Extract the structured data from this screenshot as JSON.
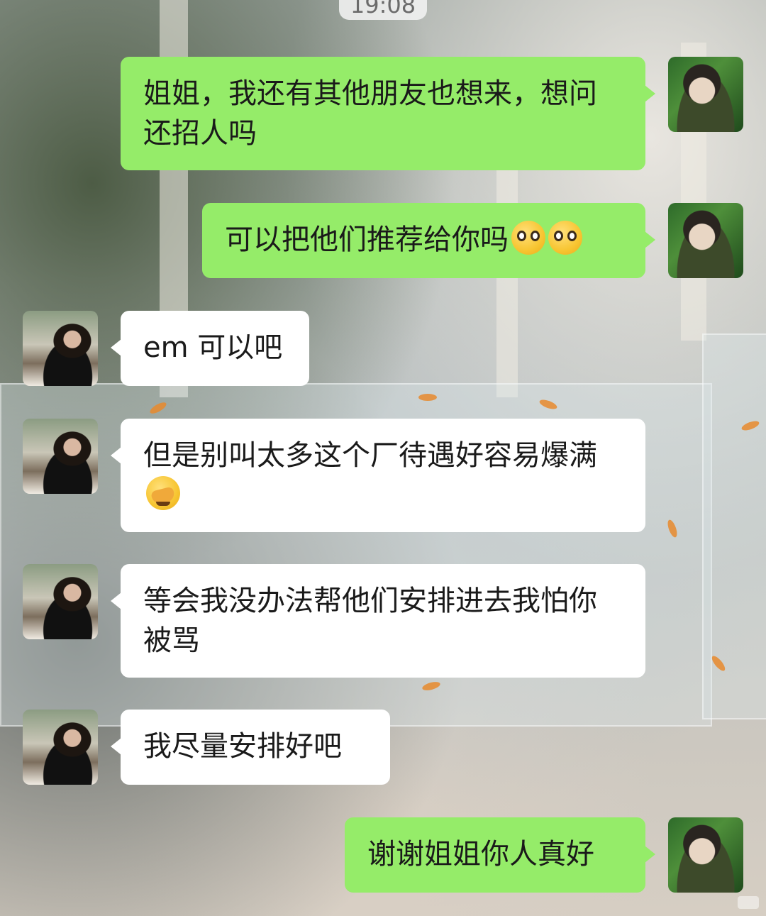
{
  "status": {
    "time": "19:08"
  },
  "messages": [
    {
      "from": "me",
      "text": "姐姐，我还有其他朋友也想来，想问还招人吗",
      "emoji": []
    },
    {
      "from": "me",
      "text": "可以把他们推荐给你吗",
      "emoji": [
        "pleading-face",
        "pleading-face"
      ]
    },
    {
      "from": "her",
      "text": "em 可以吧",
      "emoji": []
    },
    {
      "from": "her",
      "text": "但是别叫太多这个厂待遇好容易爆满",
      "emoji": [
        "face-with-hand-over-mouth"
      ]
    },
    {
      "from": "her",
      "text": "等会我没办法帮他们安排进去我怕你被骂",
      "emoji": []
    },
    {
      "from": "her",
      "text": "我尽量安排好吧",
      "emoji": []
    },
    {
      "from": "me",
      "text": "谢谢姐姐你人真好",
      "emoji": []
    }
  ],
  "colors": {
    "my_bubble": "#95ec69",
    "her_bubble": "#ffffff",
    "time_text": "#6b6b6b"
  },
  "icons": {
    "my_avatar": "user-avatar-icon",
    "her_avatar": "contact-avatar-icon"
  }
}
